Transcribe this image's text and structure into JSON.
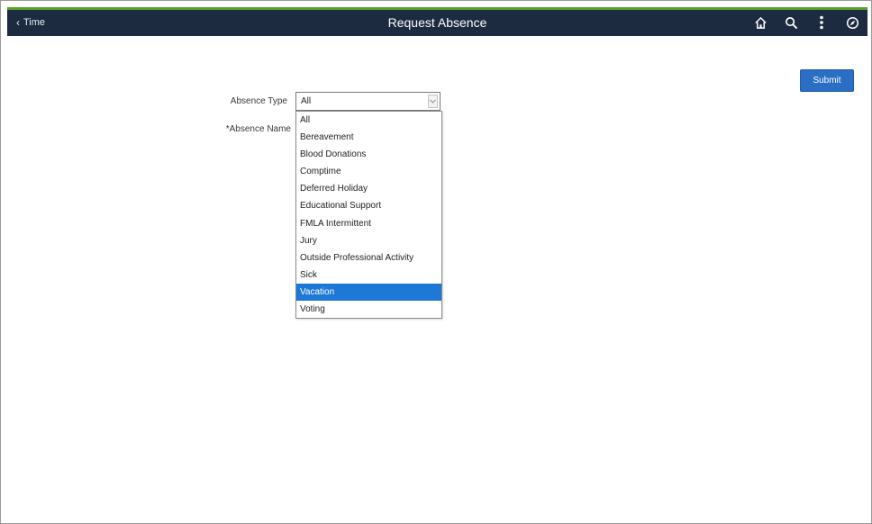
{
  "header": {
    "back_label": "Time",
    "title": "Request Absence"
  },
  "actions": {
    "submit_label": "Submit"
  },
  "form": {
    "absence_type_label": "Absence Type",
    "absence_name_label": "*Absence Name",
    "absence_type_value": "All"
  },
  "dropdown": {
    "options": [
      "All",
      "Bereavement",
      "Blood Donations",
      "Comptime",
      "Deferred Holiday",
      "Educational Support",
      "FMLA Intermittent",
      "Jury",
      "Outside Professional Activity",
      "Sick",
      "Vacation",
      "Voting"
    ],
    "highlighted": "Vacation"
  },
  "colors": {
    "header_bg": "#1c2b40",
    "accent_stripe": "#5aa02c",
    "button_blue": "#2b6fc5",
    "highlight_blue": "#1d78d6"
  },
  "icons": [
    "home-icon",
    "search-icon",
    "actions-menu-icon",
    "navbar-icon"
  ]
}
